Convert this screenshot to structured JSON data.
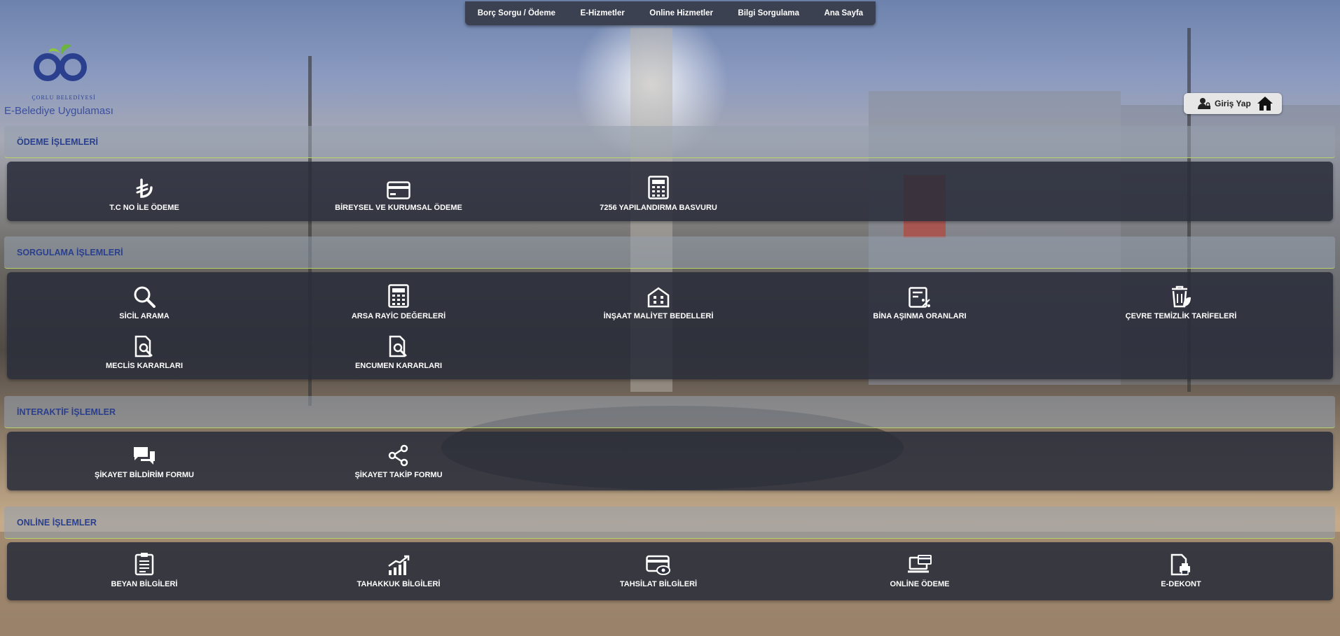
{
  "nav": {
    "items": [
      "Borç Sorgu / Ödeme",
      "E-Hizmetler",
      "Online Hizmetler",
      "Bilgi Sorgulama",
      "Ana Sayfa"
    ]
  },
  "header": {
    "logo_text": "ÇORLU BELEDİYESİ",
    "app_title": "E-Belediye Uygulaması",
    "login_label": "Giriş Yap"
  },
  "sections": {
    "odeme": {
      "title": "ÖDEME İŞLEMLERİ",
      "items": [
        {
          "label": "T.C NO İLE ÖDEME",
          "icon": "lira-icon"
        },
        {
          "label": "BİREYSEL VE KURUMSAL ÖDEME",
          "icon": "credit-card-icon"
        },
        {
          "label": "7256 YAPILANDIRMA BASVURU",
          "icon": "calculator-icon"
        }
      ]
    },
    "sorgulama": {
      "title": "SORGULAMA İŞLEMLERİ",
      "items": [
        {
          "label": "SİCİL ARAMA",
          "icon": "search-icon"
        },
        {
          "label": "ARSA RAYİC DEĞERLERİ",
          "icon": "calculator-icon"
        },
        {
          "label": "İNŞAAT MALİYET BEDELLERİ",
          "icon": "building-icon"
        },
        {
          "label": "BİNA AŞINMA ORANLARI",
          "icon": "percent-document-icon"
        },
        {
          "label": "ÇEVRE TEMİZLİK TARİFELERİ",
          "icon": "trash-leaf-icon"
        },
        {
          "label": "MECLİS KARARLARI",
          "icon": "document-search-icon"
        },
        {
          "label": "ENCUMEN KARARLARI",
          "icon": "document-search-icon"
        }
      ]
    },
    "interaktif": {
      "title": "İNTERAKTİF İŞLEMLER",
      "items": [
        {
          "label": "ŞİKAYET BİLDİRİM FORMU",
          "icon": "chat-icon"
        },
        {
          "label": "ŞİKAYET TAKİP FORMU",
          "icon": "share-icon"
        }
      ]
    },
    "online": {
      "title": "ONLİNE İŞLEMLER",
      "items": [
        {
          "label": "BEYAN BİLGİLERİ",
          "icon": "clipboard-icon"
        },
        {
          "label": "TAHAKKUK BİLGİLERİ",
          "icon": "chart-up-icon"
        },
        {
          "label": "TAHSİLAT BİLGİLERİ",
          "icon": "card-eye-icon"
        },
        {
          "label": "ONLİNE ÖDEME",
          "icon": "laptop-card-icon"
        },
        {
          "label": "E-DEKONT",
          "icon": "document-print-icon"
        }
      ]
    }
  },
  "colors": {
    "section_title": "#2a3f8e",
    "panel": "#2a2e3a",
    "accent_line": "#b9d36b"
  }
}
